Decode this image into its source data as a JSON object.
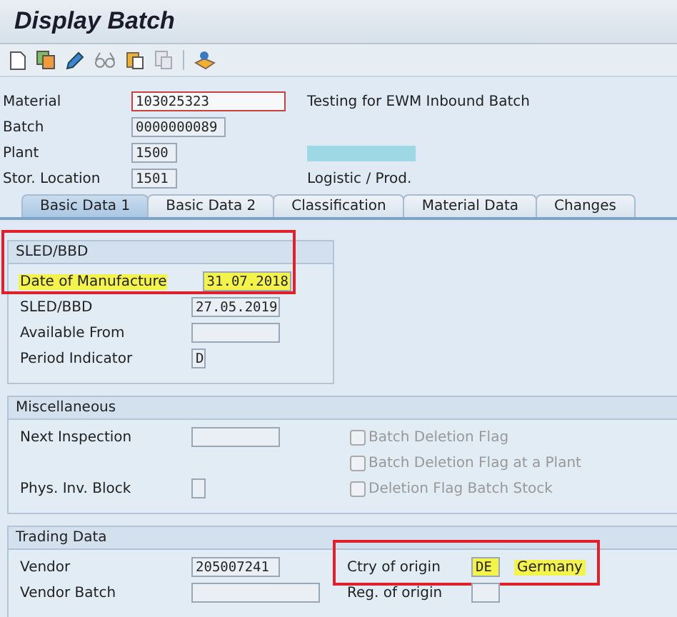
{
  "window": {
    "title": "Display Batch"
  },
  "header_fields": [
    {
      "label": "Material",
      "value": "103025323",
      "focused": true
    },
    {
      "label": "Batch",
      "value": "0000000089",
      "focused": false
    },
    {
      "label": "Plant",
      "value": "1500",
      "focused": false
    },
    {
      "label": "Stor. Location",
      "value": "1501",
      "focused": false
    }
  ],
  "header_texts": [
    {
      "kind": "text",
      "text": "Testing for EWM Inbound Batch"
    },
    {
      "kind": "blank"
    },
    {
      "kind": "bar"
    },
    {
      "kind": "text",
      "text": "Logistic / Prod."
    }
  ],
  "tabs": [
    {
      "label": "Basic Data 1",
      "selected": true
    },
    {
      "label": "Basic Data 2",
      "selected": false
    },
    {
      "label": "Classification",
      "selected": false
    },
    {
      "label": "Material Data",
      "selected": false
    },
    {
      "label": "Changes",
      "selected": false
    }
  ],
  "sections": [
    {
      "title": "SLED/BBD",
      "kind": "narrow",
      "left": [
        {
          "kind": "field",
          "label": "Date of Manufacture",
          "value": "31.07.2018",
          "highlighted": true,
          "boxed": true
        },
        {
          "kind": "field",
          "label": "SLED/BBD",
          "value": "27.05.2019",
          "highlighted": false,
          "boxed": false
        },
        {
          "kind": "field",
          "label": "Available From",
          "highlighted": false,
          "boxed": false
        },
        {
          "kind": "field",
          "label": "Period Indicator",
          "value": "D",
          "highlighted": false,
          "boxed": false
        }
      ]
    },
    {
      "title": "Miscellaneous",
      "kind": "wide",
      "left": [
        {
          "kind": "field",
          "label": "Next Inspection",
          "highlighted": false,
          "boxed": false
        },
        {
          "kind": "blank"
        },
        {
          "kind": "field",
          "label": "Phys. Inv. Block",
          "highlighted": false,
          "boxed": false
        }
      ],
      "right": [
        {
          "kind": "checkbox",
          "label": "Batch Deletion Flag",
          "checked": false,
          "disabled": true
        },
        {
          "kind": "checkbox",
          "label": "Batch Deletion Flag at a Plant",
          "checked": false,
          "disabled": true
        },
        {
          "kind": "checkbox",
          "label": "Deletion Flag Batch Stock",
          "checked": false,
          "disabled": true
        }
      ]
    },
    {
      "title": "Trading Data",
      "kind": "wide",
      "left": [
        {
          "kind": "field",
          "label": "Vendor",
          "value": "205007241",
          "highlighted": false,
          "boxed": false
        },
        {
          "kind": "field",
          "label": "Vendor Batch",
          "highlighted": false,
          "boxed": false
        }
      ],
      "right": [
        {
          "kind": "field",
          "label": "Ctry of origin",
          "value": "DE",
          "description": "Germany",
          "highlighted": true,
          "boxed": true
        },
        {
          "kind": "field",
          "label": "Reg. of origin",
          "highlighted": false,
          "boxed": false
        }
      ]
    }
  ]
}
